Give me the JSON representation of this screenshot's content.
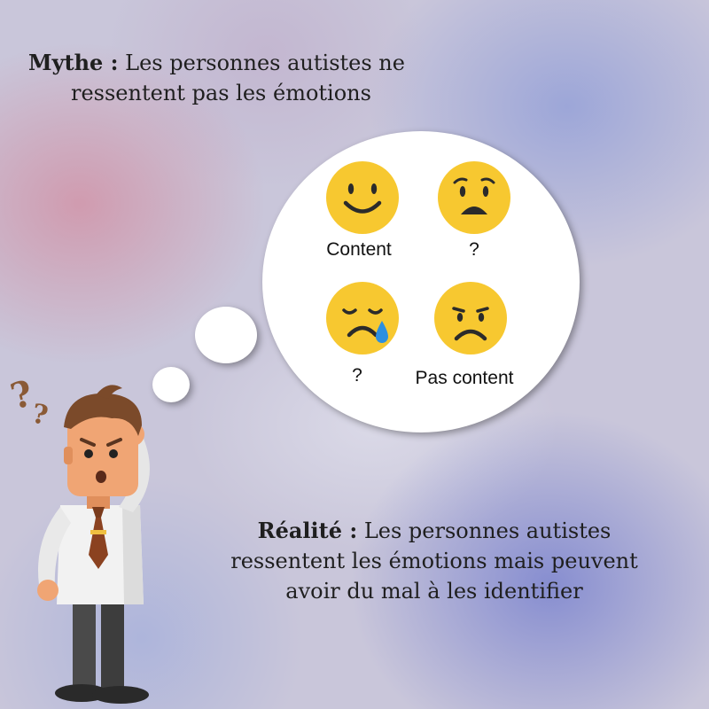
{
  "myth": {
    "prefix": "Mythe :",
    "line1": " Les personnes autistes ne",
    "line2": "ressentent pas les émotions"
  },
  "reality": {
    "prefix": "Réalité :",
    "line1": " Les personnes autistes",
    "line2": "ressentent les émotions mais peuvent",
    "line3": "avoir du mal à les identifier"
  },
  "emotions": [
    {
      "icon": "smiling-face-icon",
      "label": "Content"
    },
    {
      "icon": "worried-face-icon",
      "label": "?"
    },
    {
      "icon": "crying-face-icon",
      "label": "?"
    },
    {
      "icon": "frowning-face-icon",
      "label": "Pas content"
    }
  ],
  "colors": {
    "emoji": "#f7c830",
    "face_features": "#2b2b2b",
    "tear": "#2c8fe0",
    "question_marks": "#8a5a36"
  }
}
